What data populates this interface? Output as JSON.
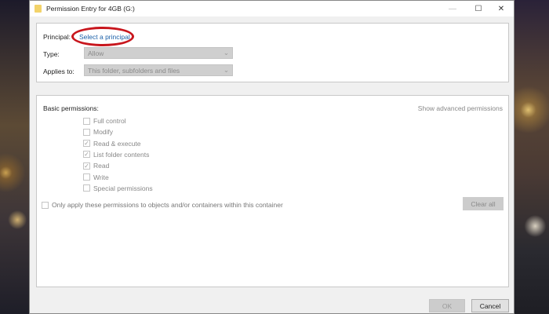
{
  "window": {
    "title": "Permission Entry for 4GB (G:)",
    "minimize": "—",
    "maximize": "☐",
    "close": "✕"
  },
  "principal": {
    "label": "Principal:",
    "link": "Select a principal"
  },
  "type": {
    "label": "Type:",
    "value": "Allow"
  },
  "applies_to": {
    "label": "Applies to:",
    "value": "This folder, subfolders and files"
  },
  "basic": {
    "label": "Basic permissions:",
    "advanced_link": "Show advanced permissions",
    "items": [
      {
        "label": "Full control",
        "checked": false
      },
      {
        "label": "Modify",
        "checked": false
      },
      {
        "label": "Read & execute",
        "checked": true
      },
      {
        "label": "List folder contents",
        "checked": true
      },
      {
        "label": "Read",
        "checked": true
      },
      {
        "label": "Write",
        "checked": false
      },
      {
        "label": "Special permissions",
        "checked": false
      }
    ]
  },
  "only_apply": {
    "label": "Only apply these permissions to objects and/or containers within this container",
    "checked": false
  },
  "buttons": {
    "clear_all": "Clear all",
    "ok": "OK",
    "cancel": "Cancel"
  },
  "colors": {
    "annotation_ring": "#c8161d",
    "link": "#1a5fa8"
  }
}
